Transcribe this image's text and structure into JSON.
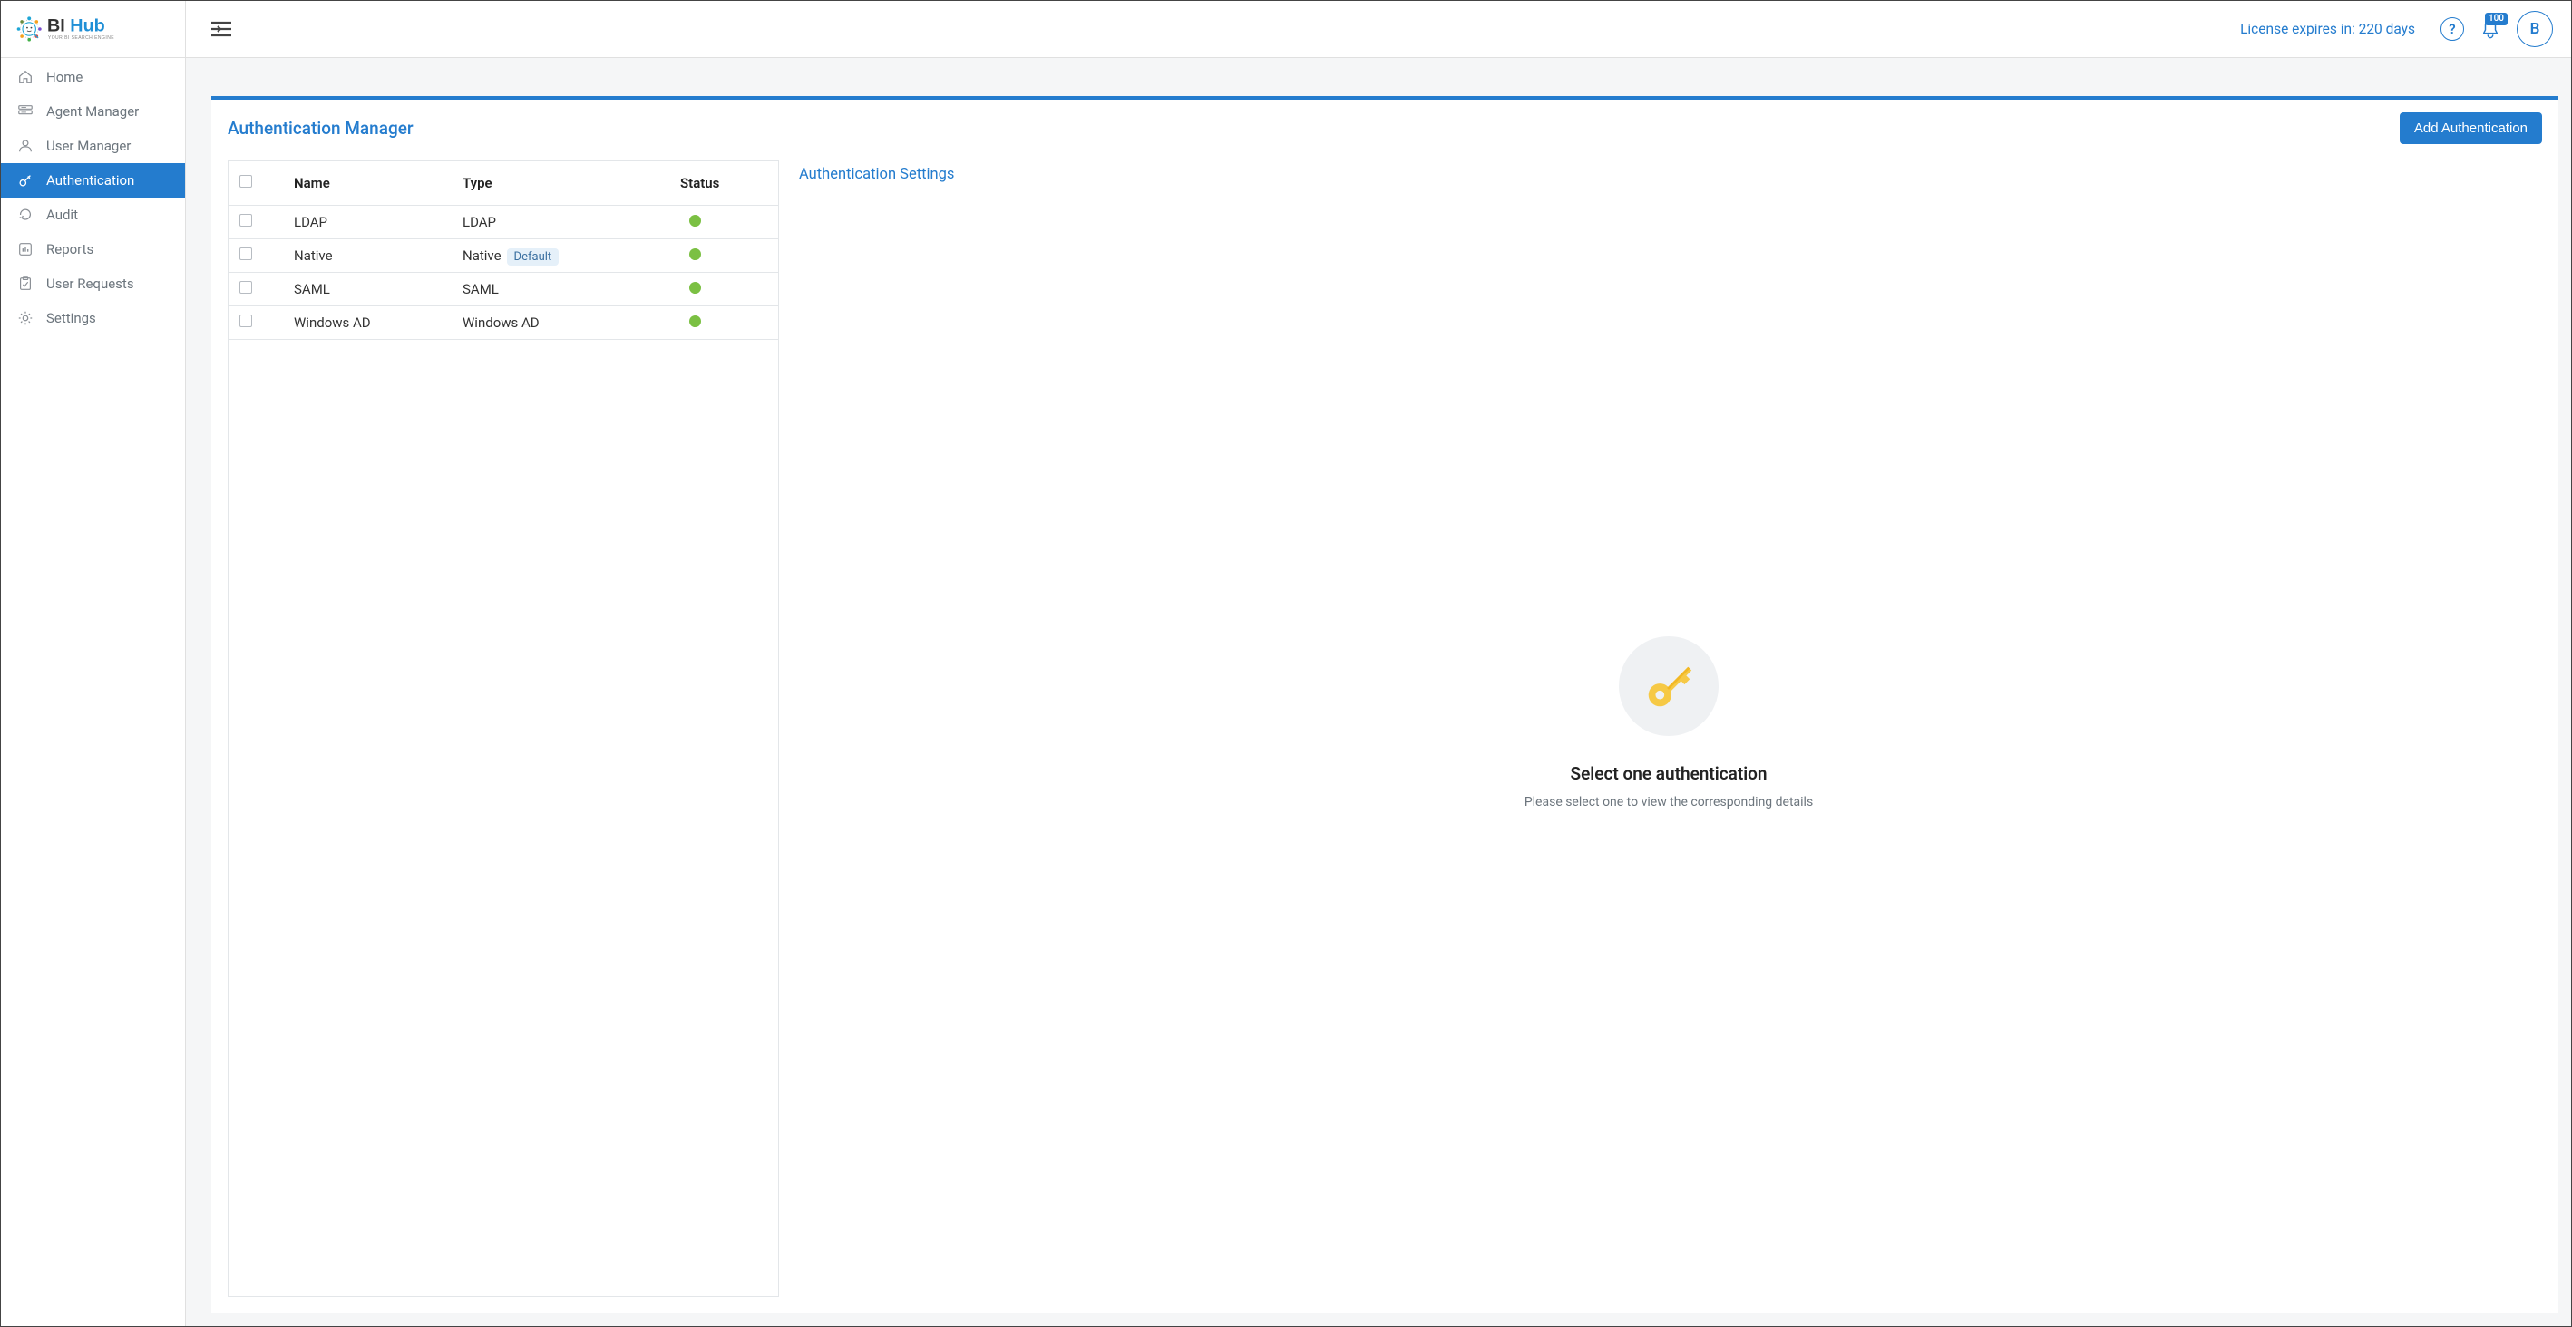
{
  "brand": {
    "name": "BI Hub",
    "tagline": "YOUR BI SEARCH ENGINE"
  },
  "header": {
    "license_text": "License expires in: 220 days",
    "notification_count": "100",
    "avatar_initial": "B"
  },
  "sidebar": {
    "items": [
      {
        "label": "Home",
        "icon": "home-icon"
      },
      {
        "label": "Agent Manager",
        "icon": "server-icon"
      },
      {
        "label": "User Manager",
        "icon": "user-icon"
      },
      {
        "label": "Authentication",
        "icon": "key-icon",
        "active": true
      },
      {
        "label": "Audit",
        "icon": "refresh-icon"
      },
      {
        "label": "Reports",
        "icon": "chart-icon"
      },
      {
        "label": "User Requests",
        "icon": "clipboard-icon"
      },
      {
        "label": "Settings",
        "icon": "gear-icon"
      }
    ]
  },
  "page": {
    "title": "Authentication Manager",
    "add_button": "Add Authentication",
    "settings_title": "Authentication Settings"
  },
  "table": {
    "columns": {
      "name": "Name",
      "type": "Type",
      "status": "Status"
    },
    "default_tag": "Default",
    "rows": [
      {
        "name": "LDAP",
        "type": "LDAP",
        "default": false,
        "status": "green"
      },
      {
        "name": "Native",
        "type": "Native",
        "default": true,
        "status": "green"
      },
      {
        "name": "SAML",
        "type": "SAML",
        "default": false,
        "status": "green"
      },
      {
        "name": "Windows AD",
        "type": "Windows AD",
        "default": false,
        "status": "green"
      }
    ]
  },
  "empty_state": {
    "title": "Select one authentication",
    "subtitle": "Please select one to view the corresponding details"
  },
  "colors": {
    "primary": "#247cce",
    "status_green": "#7bc043"
  }
}
